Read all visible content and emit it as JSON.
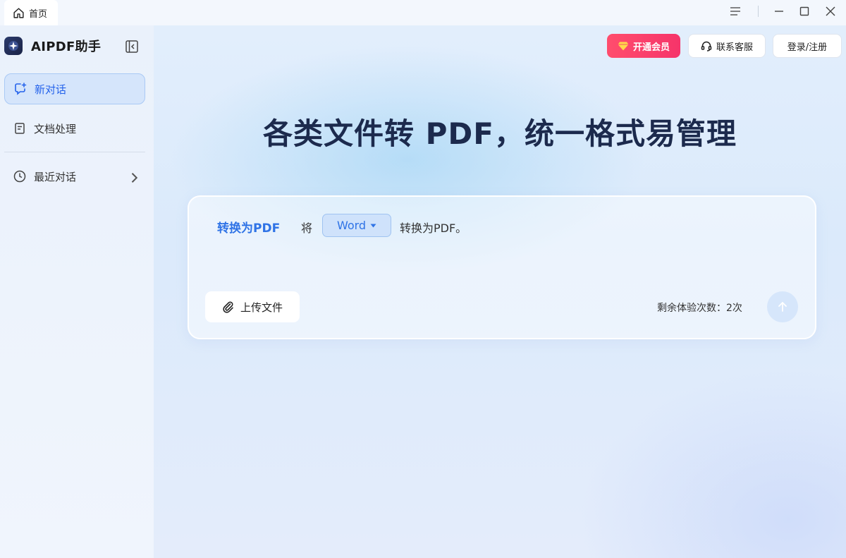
{
  "titlebar": {
    "tab_label": "首页",
    "tab_icon": "home-icon",
    "controls": [
      "menu-icon",
      "minimize-icon",
      "maximize-icon",
      "close-icon"
    ]
  },
  "sidebar": {
    "brand_name": "AIPDF助手",
    "items": [
      {
        "label": "新对话",
        "icon": "new-chat-icon",
        "active": true
      },
      {
        "label": "文档处理",
        "icon": "document-icon",
        "active": false
      },
      {
        "label": "最近对话",
        "icon": "clock-icon",
        "active": false
      }
    ]
  },
  "header": {
    "vip_label": "开通会员",
    "service_label": "联系客服",
    "login_label": "登录/注册"
  },
  "main": {
    "hero_title": "各类文件转 PDF，统一格式易管理",
    "composer": {
      "mode_label": "转换为PDF",
      "pre_text": "将",
      "format_selected": "Word",
      "post_text": "转换为PDF。",
      "upload_label": "上传文件",
      "remaining_text": "剩余体验次数：2次"
    }
  },
  "colors": {
    "accent": "#2f73e6",
    "vip": "#f6346a",
    "title": "#1c2a4d"
  }
}
